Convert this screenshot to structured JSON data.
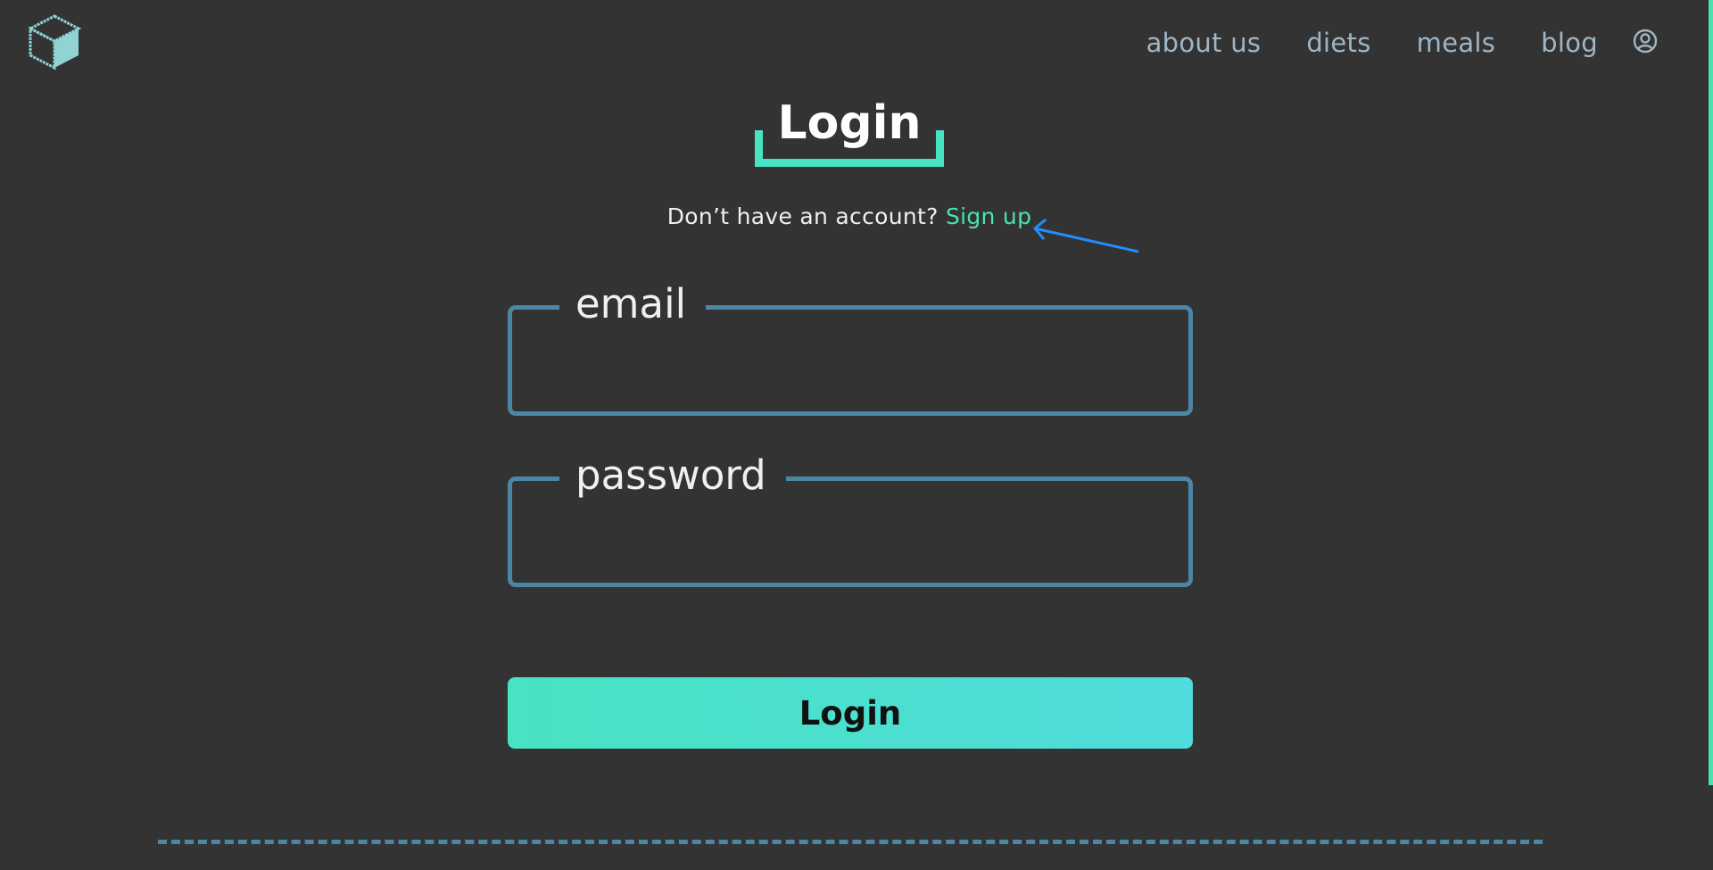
{
  "header": {
    "logo_icon": "cube-icon",
    "nav": [
      {
        "label": "about us"
      },
      {
        "label": "diets"
      },
      {
        "label": "meals"
      },
      {
        "label": "blog"
      }
    ],
    "account_icon": "user-circle-icon"
  },
  "main": {
    "title": "Login",
    "signup_prompt": "Don’t have an account?",
    "signup_link": "Sign up",
    "fields": {
      "email": {
        "label": "email",
        "value": ""
      },
      "password": {
        "label": "password",
        "value": ""
      }
    },
    "login_button": "Login"
  },
  "colors": {
    "background": "#333333",
    "accent": "#48e3c2",
    "field_border": "#4b87a5",
    "nav_text": "#9fb6c6",
    "annotation_arrow": "#1e90ff"
  }
}
